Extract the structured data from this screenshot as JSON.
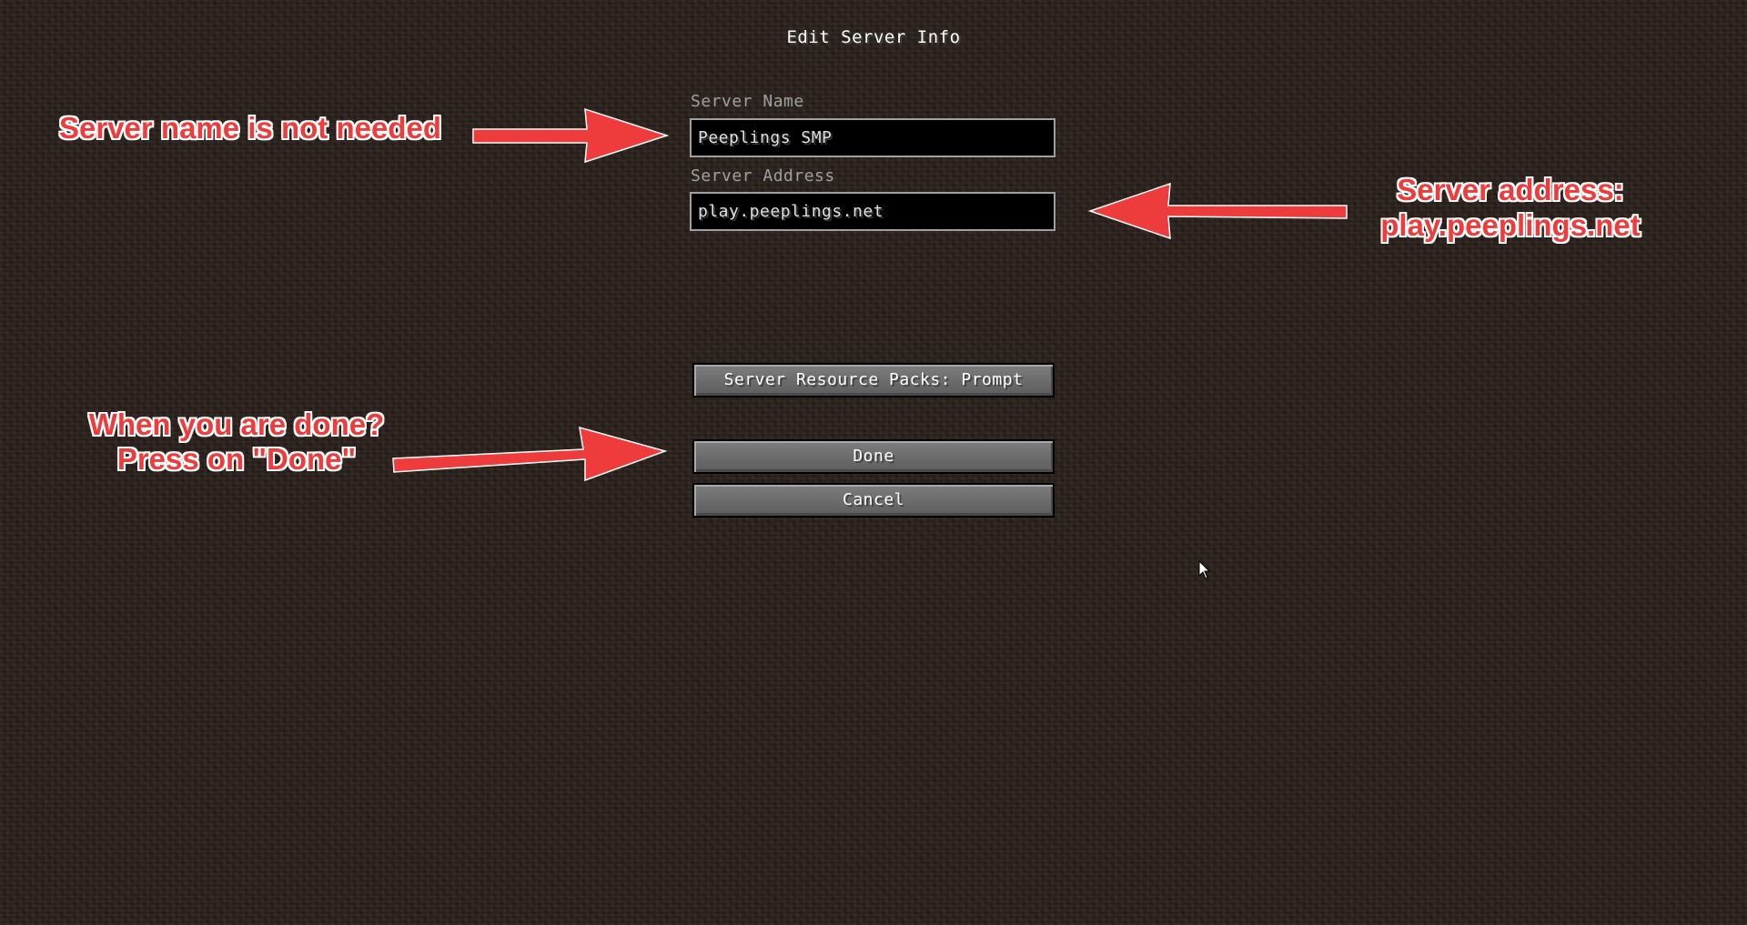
{
  "screen": {
    "title": "Edit Server Info"
  },
  "form": {
    "server_name_label": "Server Name",
    "server_name_value": "Peeplings SMP",
    "server_address_label": "Server Address",
    "server_address_value": "play.peeplings.net"
  },
  "buttons": {
    "resource_packs": "Server Resource Packs: Prompt",
    "done": "Done",
    "cancel": "Cancel"
  },
  "annotations": {
    "server_name_note": "Server name is not needed",
    "server_address_note_line1": "Server address:",
    "server_address_note_line2": "play.peeplings.net",
    "done_note_line1": "When you are done?",
    "done_note_line2": "Press on \"Done\""
  },
  "colors": {
    "annotation": "#ee3c3c",
    "background": "#2a211b"
  },
  "icons": {
    "cursor": "mouse-pointer-icon",
    "arrow": "red-arrow-icon"
  }
}
